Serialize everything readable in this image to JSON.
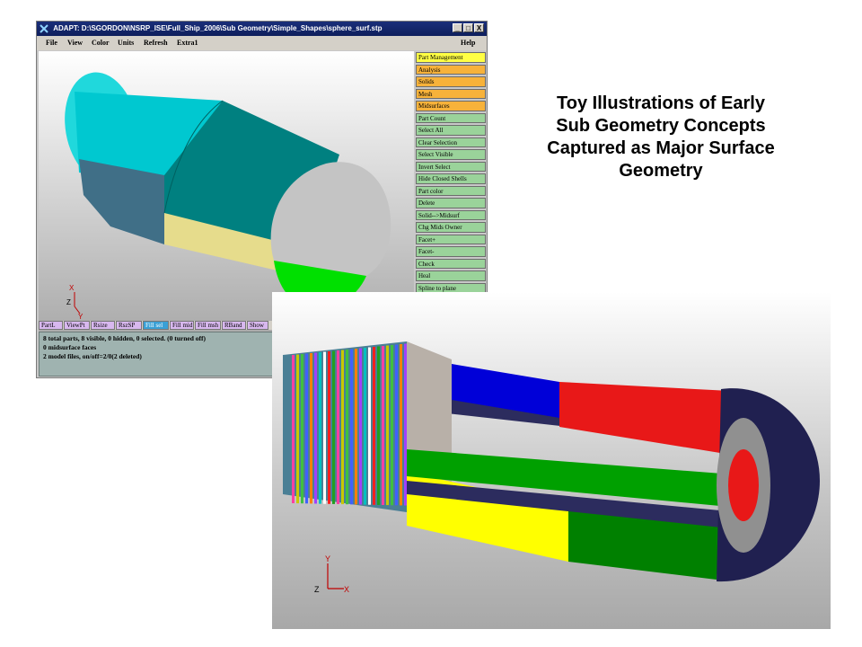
{
  "window": {
    "title": "ADAPT: D:\\SGORDON\\NSRP_ISE\\Full_Ship_2006\\Sub Geometry\\Simple_Shapes\\sphere_surf.stp",
    "controls": [
      "_",
      "□",
      "X"
    ]
  },
  "menu": {
    "file": "File",
    "view": "View",
    "color": "Color",
    "units": "Units",
    "refresh": "Refresh",
    "extra": "Extra1",
    "help": "Help"
  },
  "side_panel": [
    {
      "label": "Part Management",
      "style": "y"
    },
    {
      "label": "Analysis",
      "style": "o"
    },
    {
      "label": "Solids",
      "style": "o"
    },
    {
      "label": "Mesh",
      "style": "o"
    },
    {
      "label": "Midsurfaces",
      "style": "o"
    },
    {
      "label": "Part Count",
      "style": "g"
    },
    {
      "label": "Select All",
      "style": "g"
    },
    {
      "label": "Clear Selection",
      "style": "g"
    },
    {
      "label": "Select Visible",
      "style": "g"
    },
    {
      "label": "Invert Select",
      "style": "g"
    },
    {
      "label": "Hide Closed Shells",
      "style": "g"
    },
    {
      "label": "Part color",
      "style": "g"
    },
    {
      "label": "Delete",
      "style": "g"
    },
    {
      "label": "Solid-->Midsurf",
      "style": "g"
    },
    {
      "label": "Chg Mids Owner",
      "style": "g"
    },
    {
      "label": "Facet+",
      "style": "g"
    },
    {
      "label": "Facet-",
      "style": "g"
    },
    {
      "label": "Check",
      "style": "g"
    },
    {
      "label": "Heal",
      "style": "g"
    },
    {
      "label": "Spline to plane",
      "style": "g"
    }
  ],
  "tabs": [
    "PartL",
    "ViewPt",
    "Rsize",
    "RszSP",
    "Fill sel",
    "Fill mid",
    "Fill msh",
    "RBand",
    "Show"
  ],
  "selected_tab": "Fill sel",
  "console_lines": [
    "8 total parts,  8 visible, 0 hidden, 0 selected. (0 turned off)",
    "0 midsurface faces",
    "2 model files, on/off=2/0(2 deleted)"
  ],
  "axes_small": {
    "x": "X",
    "z": "Z",
    "y": "Y"
  },
  "axes_large": {
    "y": "Y",
    "z": "Z",
    "x": "X"
  },
  "headline_lines": [
    "Toy Illustrations of Early",
    "Sub Geometry Concepts",
    "Captured as Major Surface",
    "Geometry"
  ],
  "colors": {
    "title_bar": "#1a2f7a",
    "cyan": "#00c8d0",
    "teal": "#008080",
    "khaki": "#e6dc8c",
    "sphere_grey": "#c0c0c0",
    "green": "#00e000",
    "steel": "#406f87",
    "navy": "#2c2c5e",
    "red": "#e81818",
    "blue": "#0000d8",
    "yellow": "#ffff00",
    "dark_green": "#008000"
  }
}
